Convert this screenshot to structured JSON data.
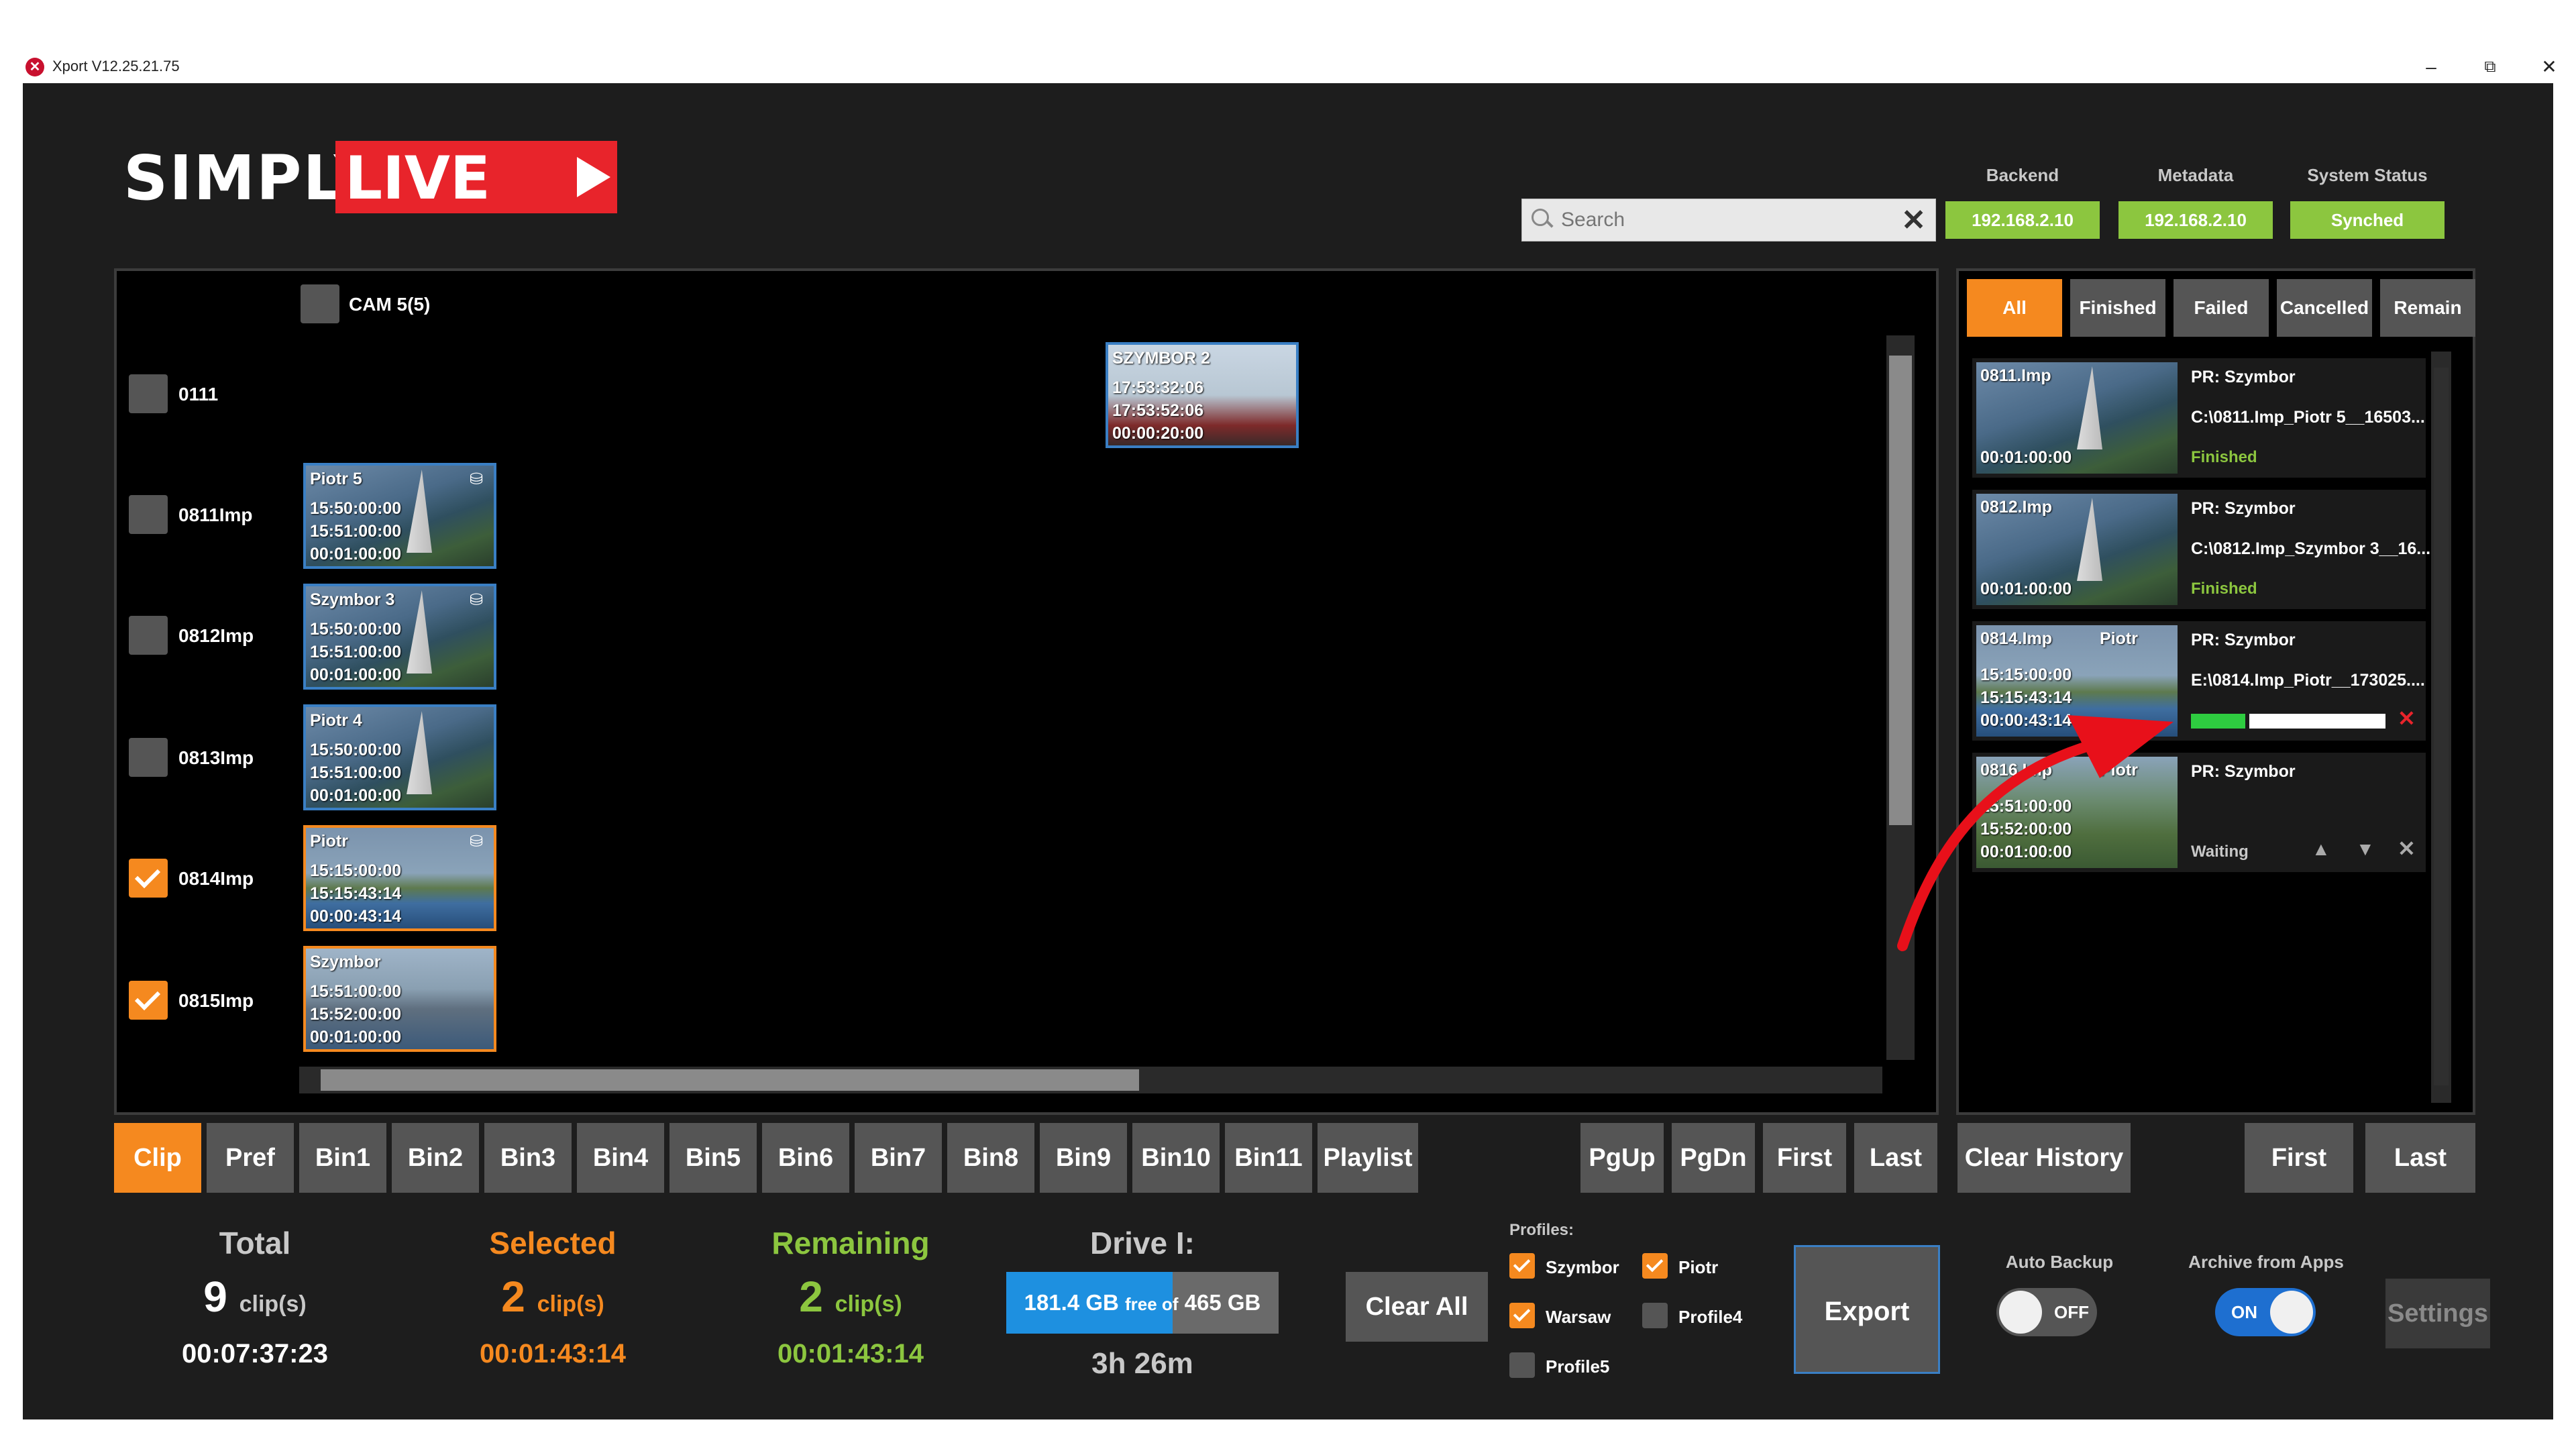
{
  "window": {
    "title": "Xport V12.25.21.75",
    "app_icon": "Xport app icon",
    "minimize": "–",
    "restore": "⧉",
    "close": "✕"
  },
  "logo": {
    "simply": "SIMPLY",
    "live": "LIVE"
  },
  "search": {
    "placeholder": "Search"
  },
  "status": {
    "backend_label": "Backend",
    "backend_value": "192.168.2.10",
    "metadata_label": "Metadata",
    "metadata_value": "192.168.2.10",
    "system_label": "System Status",
    "system_value": "Synched",
    "color_ok": "#8cc63f"
  },
  "grid": {
    "cam_header": "CAM 5(5)",
    "rows": [
      {
        "label": "0111",
        "checked": false
      },
      {
        "label": "0811Imp",
        "checked": false
      },
      {
        "label": "0812Imp",
        "checked": false
      },
      {
        "label": "0813Imp",
        "checked": false
      },
      {
        "label": "0814Imp",
        "checked": true
      },
      {
        "label": "0815Imp",
        "checked": true
      }
    ],
    "clips": [
      {
        "name": "SZYMBOR 2",
        "in": "17:53:32:06",
        "out": "17:53:52:06",
        "dur": "00:00:20:00"
      },
      {
        "name": "Piotr 5",
        "in": "15:50:00:00",
        "out": "15:51:00:00",
        "dur": "00:01:00:00"
      },
      {
        "name": "Szymbor 3",
        "in": "15:50:00:00",
        "out": "15:51:00:00",
        "dur": "00:01:00:00"
      },
      {
        "name": "Piotr 4",
        "in": "15:50:00:00",
        "out": "15:51:00:00",
        "dur": "00:01:00:00"
      },
      {
        "name": "Piotr",
        "in": "15:15:00:00",
        "out": "15:15:43:14",
        "dur": "00:00:43:14"
      },
      {
        "name": "Szymbor",
        "in": "15:51:00:00",
        "out": "15:52:00:00",
        "dur": "00:01:00:00"
      }
    ]
  },
  "filters": {
    "all": "All",
    "finished": "Finished",
    "failed": "Failed",
    "cancelled": "Cancelled",
    "remain": "Remain"
  },
  "jobs": [
    {
      "name": "0811.Imp",
      "dur": "00:01:00:00",
      "profile": "PR: Szymbor",
      "path": "C:\\0811.Imp_Piotr 5__16503...",
      "status": "Finished"
    },
    {
      "name": "0812.Imp",
      "dur": "00:01:00:00",
      "profile": "PR: Szymbor",
      "path": "C:\\0812.Imp_Szymbor 3__16...",
      "status": "Finished"
    },
    {
      "name": "0814.Imp",
      "name2": "Piotr",
      "in": "15:15:00:00",
      "out": "15:15:43:14",
      "dur": "00:00:43:14",
      "profile": "PR: Szymbor",
      "path": "E:\\0814.Imp_Piotr__173025....",
      "progress": 0.28
    },
    {
      "name": "0816.Imp",
      "name2": "Piotr",
      "in": "15:51:00:00",
      "out": "15:52:00:00",
      "dur": "00:01:00:00",
      "profile": "PR: Szymbor",
      "status": "Waiting"
    }
  ],
  "bins": [
    "Clip",
    "Pref",
    "Bin1",
    "Bin2",
    "Bin3",
    "Bin4",
    "Bin5",
    "Bin6",
    "Bin7",
    "Bin8",
    "Bin9",
    "Bin10",
    "Bin11",
    "Playlist"
  ],
  "nav": {
    "pgup": "PgUp",
    "pgdn": "PgDn",
    "first": "First",
    "last": "Last",
    "clear_history": "Clear History",
    "first2": "First",
    "last2": "Last"
  },
  "stats": {
    "total_label": "Total",
    "total_count": "9",
    "total_time": "00:07:37:23",
    "selected_label": "Selected",
    "selected_count": "2",
    "selected_time": "00:01:43:14",
    "remaining_label": "Remaining",
    "remaining_count": "2",
    "remaining_time": "00:01:43:14",
    "clips_unit": "clip(s)",
    "colors": {
      "total": "#c8c8c8",
      "selected": "#f5891f",
      "remaining": "#8cc63f"
    }
  },
  "drive": {
    "label": "Drive I:",
    "free": "181.4 GB",
    "free_of": "free of",
    "total": "465 GB",
    "time": "3h 26m",
    "free_fraction": 0.61
  },
  "clear_all": "Clear All",
  "profiles": {
    "label": "Profiles:",
    "items": [
      {
        "name": "Szymbor",
        "checked": true
      },
      {
        "name": "Piotr",
        "checked": true
      },
      {
        "name": "Warsaw",
        "checked": true
      },
      {
        "name": "Profile4",
        "checked": false
      },
      {
        "name": "Profile5",
        "checked": false
      }
    ]
  },
  "export": "Export",
  "auto_backup": {
    "label": "Auto Backup",
    "state": "OFF"
  },
  "archive": {
    "label": "Archive from Apps",
    "state": "ON"
  },
  "settings": "Settings"
}
